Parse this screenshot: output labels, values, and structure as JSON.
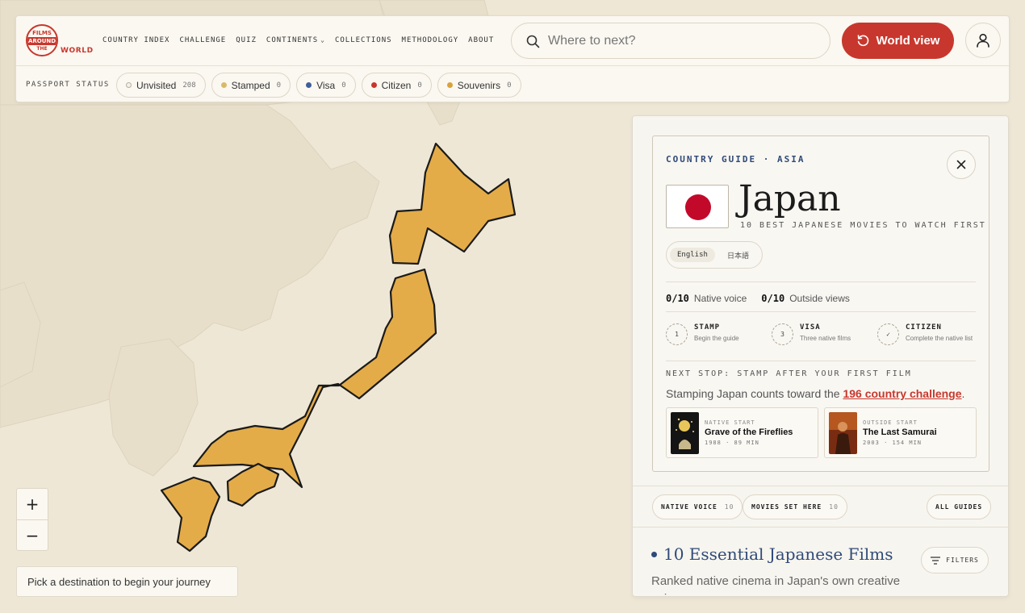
{
  "logo": {
    "line1": "FILMS",
    "line2": "AROUND",
    "line3": "THE",
    "world": "WORLD"
  },
  "nav": [
    {
      "label": "COUNTRY INDEX"
    },
    {
      "label": "CHALLENGE"
    },
    {
      "label": "QUIZ"
    },
    {
      "label": "CONTINENTS",
      "dropdown": true
    },
    {
      "label": "COLLECTIONS"
    },
    {
      "label": "METHODOLOGY"
    },
    {
      "label": "ABOUT"
    }
  ],
  "search": {
    "placeholder": "Where to next?"
  },
  "world_button": {
    "label": "World view"
  },
  "passport": {
    "label": "PASSPORT STATUS",
    "chips": [
      {
        "label": "Unvisited",
        "count": "208",
        "color": "#f4f0e6",
        "border": "#b5ae9f"
      },
      {
        "label": "Stamped",
        "count": "0",
        "color": "#d9b96b",
        "border": "#d9b96b"
      },
      {
        "label": "Visa",
        "count": "0",
        "color": "#3e5f9a",
        "border": "#3e5f9a"
      },
      {
        "label": "Citizen",
        "count": "0",
        "color": "#c8372d",
        "border": "#c8372d"
      },
      {
        "label": "Souvenirs",
        "count": "0",
        "color": "#d8a33a",
        "border": "#d8a33a"
      }
    ]
  },
  "map": {
    "highlight_color": "#e4ac48",
    "land_color": "#e8dfcb",
    "sea_color": "#efe7d6"
  },
  "zoom": {
    "in": "+",
    "out": "−"
  },
  "pick": "Pick a destination to begin your journey",
  "panel": {
    "guide_label": "COUNTRY GUIDE · ASIA",
    "country": "Japan",
    "subtitle": "10 BEST JAPANESE MOVIES TO WATCH FIRST",
    "languages": [
      {
        "label": "English",
        "active": true
      },
      {
        "label": "日本語",
        "active": false
      }
    ],
    "progress": [
      {
        "value": "0/10",
        "label": "Native voice"
      },
      {
        "value": "0/10",
        "label": "Outside views"
      }
    ],
    "steps": [
      {
        "num": "1",
        "title": "STAMP",
        "desc": "Begin the guide"
      },
      {
        "num": "3",
        "title": "VISA",
        "desc": "Three native films"
      },
      {
        "num": "✓",
        "title": "CITIZEN",
        "desc": "Complete the native list"
      }
    ],
    "next_stop": "NEXT STOP: STAMP AFTER YOUR FIRST FILM",
    "stamp_text": "Stamping Japan counts toward the ",
    "stamp_link": "196 country challenge",
    "stamp_end": ".",
    "films": [
      {
        "label": "NATIVE START",
        "title": "Grave of the Fireflies",
        "meta": "1988 · 89 MIN"
      },
      {
        "label": "OUTSIDE START",
        "title": "The Last Samurai",
        "meta": "2003 · 154 MIN"
      }
    ],
    "tabs": [
      {
        "label": "NATIVE VOICE",
        "count": "10"
      },
      {
        "label": "MOVIES SET HERE",
        "count": "10"
      }
    ],
    "all_guides": "ALL GUIDES",
    "list_title": "10 Essential Japanese Films",
    "filters": "FILTERS",
    "list_desc": "Ranked native cinema in Japan's own creative voice."
  }
}
